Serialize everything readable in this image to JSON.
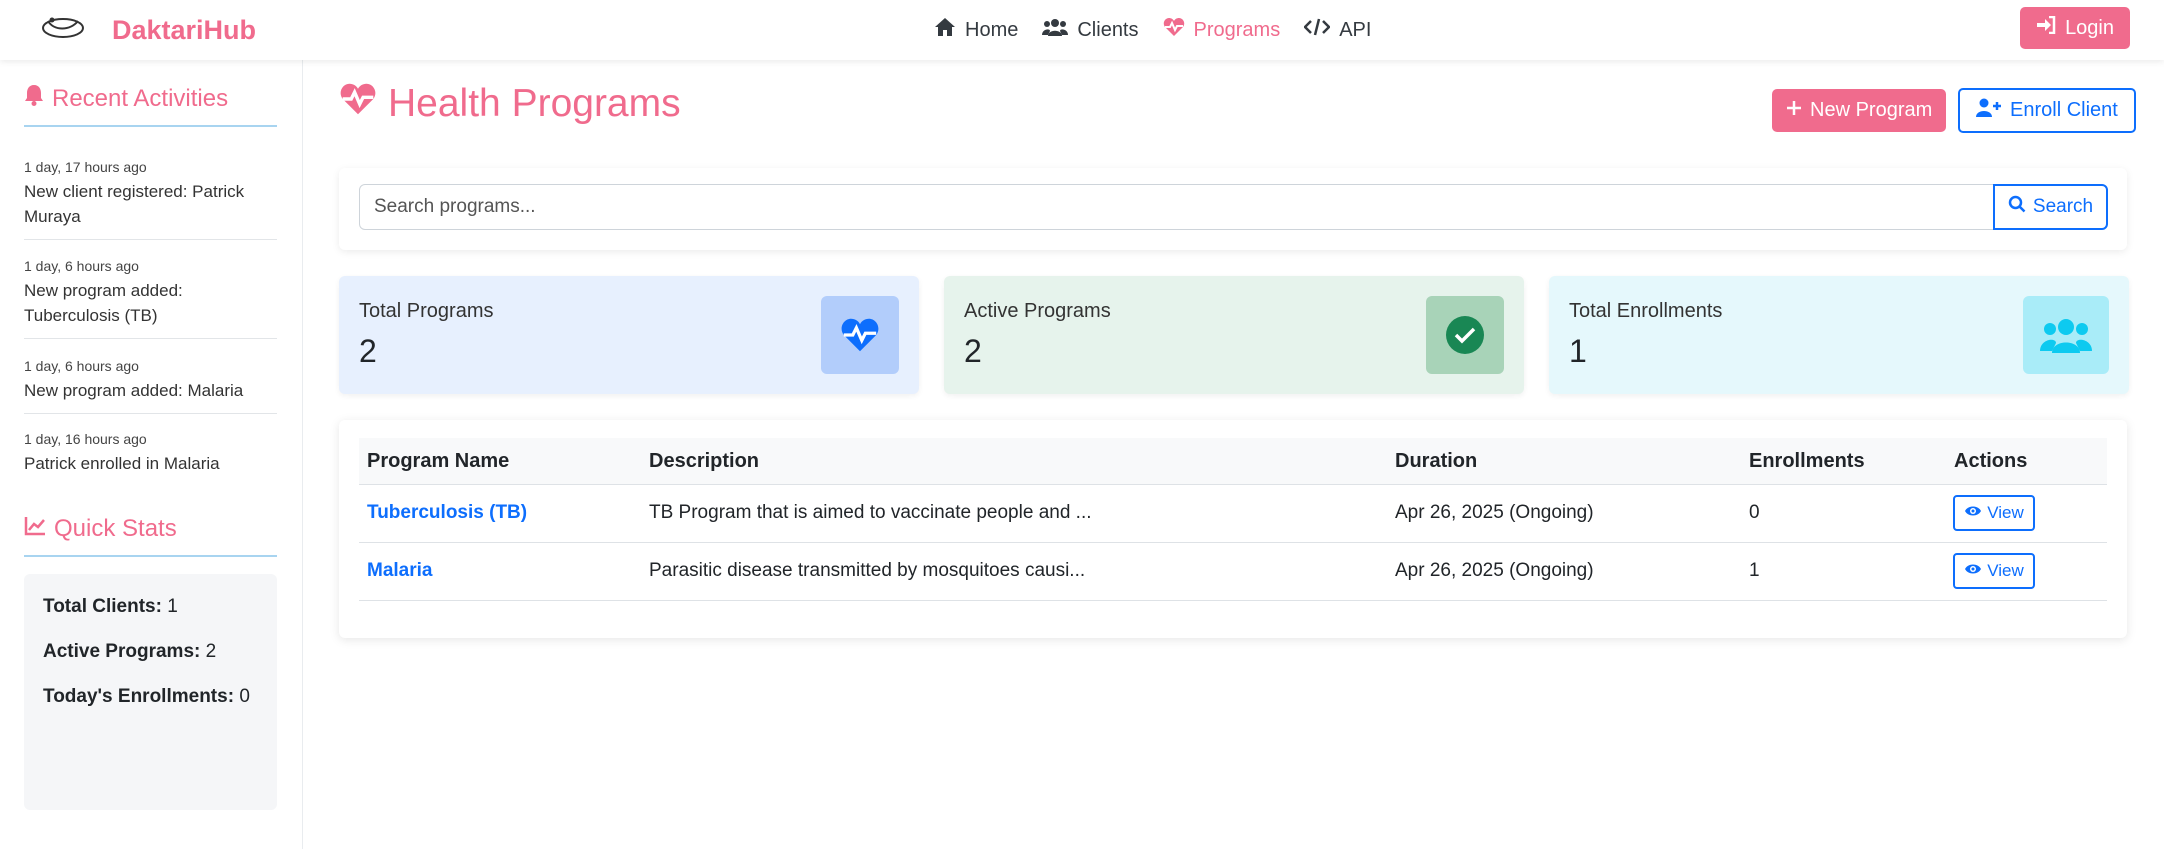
{
  "brand": {
    "name": "DaktariHub"
  },
  "nav": {
    "items": [
      {
        "label": "Home",
        "icon": "home-icon"
      },
      {
        "label": "Clients",
        "icon": "users-icon"
      },
      {
        "label": "Programs",
        "icon": "heartbeat-icon",
        "active": true
      },
      {
        "label": "API",
        "icon": "code-icon"
      }
    ],
    "login_label": "Login"
  },
  "sidebar": {
    "recent_title": "Recent Activities",
    "activities": [
      {
        "time": "1 day, 17 hours ago",
        "text": "New client registered: Patrick Muraya"
      },
      {
        "time": "1 day, 6 hours ago",
        "text": "New program added: Tuberculosis (TB)"
      },
      {
        "time": "1 day, 6 hours ago",
        "text": "New program added: Malaria"
      },
      {
        "time": "1 day, 16 hours ago",
        "text": "Patrick enrolled in Malaria"
      }
    ],
    "quick_stats_title": "Quick Stats",
    "quick_stats": [
      {
        "label": "Total Clients:",
        "value": "1"
      },
      {
        "label": "Active Programs:",
        "value": "2"
      },
      {
        "label": "Today's Enrollments:",
        "value": "0"
      }
    ]
  },
  "main": {
    "title": "Health Programs",
    "new_program_label": "New Program",
    "enroll_client_label": "Enroll Client",
    "search": {
      "placeholder": "Search programs...",
      "value": "",
      "button_label": "Search"
    },
    "stat_cards": [
      {
        "label": "Total Programs",
        "value": "2",
        "bg": "#e7f0fe",
        "icon_bg": "#b2cdfb",
        "icon_color": "#0d6efd"
      },
      {
        "label": "Active Programs",
        "value": "2",
        "bg": "#e6f3ec",
        "icon_bg": "#a8d3b8",
        "icon_color": "#198754"
      },
      {
        "label": "Total Enrollments",
        "value": "1",
        "bg": "#e5f8fc",
        "icon_bg": "#a9ecf8",
        "icon_color": "#0dcaf0"
      }
    ],
    "table": {
      "headers": [
        "Program Name",
        "Description",
        "Duration",
        "Enrollments",
        "Actions"
      ],
      "rows": [
        {
          "name": "Tuberculosis (TB)",
          "description": "TB Program that is aimed to vaccinate people and ...",
          "duration": "Apr 26, 2025 (Ongoing)",
          "enrollments": "0",
          "action": "View"
        },
        {
          "name": "Malaria",
          "description": "Parasitic disease transmitted by mosquitoes causi...",
          "duration": "Apr 26, 2025 (Ongoing)",
          "enrollments": "1",
          "action": "View"
        }
      ]
    }
  },
  "colors": {
    "accent": "#f06b8d",
    "primary": "#0d6efd"
  }
}
